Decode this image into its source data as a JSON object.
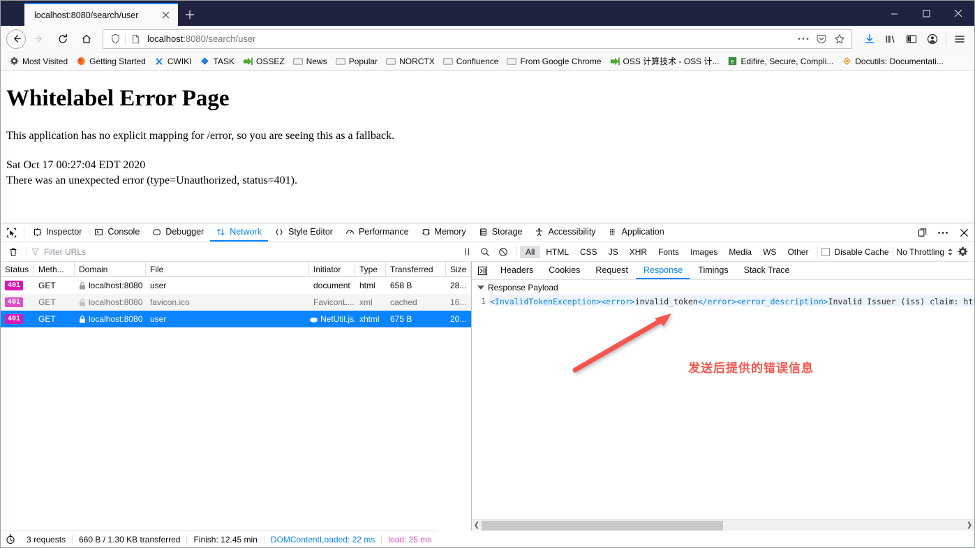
{
  "window": {
    "minimize": "—",
    "maximize": "▢",
    "close": "✕"
  },
  "tabs": [
    {
      "title": "localhost:8080/search/user",
      "close": "✕"
    }
  ],
  "newtab_label": "+",
  "nav": {
    "back": "←",
    "forward": "→",
    "reload": "⟳",
    "home": "⌂",
    "url_display": "localhost:8080/search/user",
    "url_host": "localhost",
    "url_rest": ":8080/search/user",
    "page_actions": "•••",
    "pocket": "save-to-pocket",
    "bookmark_star": "☆"
  },
  "toolbar_icons": [
    {
      "name": "downloads-icon",
      "glyph": "⭳"
    },
    {
      "name": "library-icon",
      "glyph": "|||\\"
    },
    {
      "name": "sidebar-icon",
      "glyph": "▤"
    },
    {
      "name": "account-icon",
      "glyph": "☻"
    },
    {
      "name": "menu-icon",
      "glyph": "☰"
    }
  ],
  "bookmarks": [
    {
      "label": "Most Visited",
      "icon": "gear-icon"
    },
    {
      "label": "Getting Started",
      "icon": "firefox-icon"
    },
    {
      "label": "CWIKI",
      "icon": "cwiki-icon"
    },
    {
      "label": "TASK",
      "icon": "diamond-icon"
    },
    {
      "label": "OSSEZ",
      "icon": "green-arrow-icon"
    },
    {
      "label": "News",
      "icon": "folder-icon"
    },
    {
      "label": "Popular",
      "icon": "folder-icon"
    },
    {
      "label": "NORCTX",
      "icon": "folder-icon"
    },
    {
      "label": "Confluence",
      "icon": "folder-icon"
    },
    {
      "label": "From Google Chrome",
      "icon": "folder-icon"
    },
    {
      "label": "OSS 计算技术 - OSS 计...",
      "icon": "green-arrow-icon"
    },
    {
      "label": "Edifire, Secure, Compli...",
      "icon": "edifire-icon"
    },
    {
      "label": "Docutils: Documentati...",
      "icon": "docutils-icon"
    }
  ],
  "page": {
    "heading": "Whitelabel Error Page",
    "paragraph": "This application has no explicit mapping for /error, so you are seeing this as a fallback.",
    "timestamp": "Sat Oct 17 00:27:04 EDT 2020",
    "error_line": "There was an unexpected error (type=Unauthorized, status=401)."
  },
  "devtools": {
    "picker_icon": "element-picker-icon",
    "tabs": [
      {
        "label": "Inspector",
        "icon": "inspector-icon",
        "active": false
      },
      {
        "label": "Console",
        "icon": "console-icon",
        "active": false
      },
      {
        "label": "Debugger",
        "icon": "debugger-icon",
        "active": false
      },
      {
        "label": "Network",
        "icon": "network-icon",
        "active": true
      },
      {
        "label": "Style Editor",
        "icon": "style-editor-icon",
        "active": false
      },
      {
        "label": "Performance",
        "icon": "performance-icon",
        "active": false
      },
      {
        "label": "Memory",
        "icon": "memory-icon",
        "active": false
      },
      {
        "label": "Storage",
        "icon": "storage-icon",
        "active": false
      },
      {
        "label": "Accessibility",
        "icon": "accessibility-icon",
        "active": false
      },
      {
        "label": "Application",
        "icon": "application-icon",
        "active": false
      }
    ],
    "right_buttons": [
      {
        "name": "dock-to-side-icon",
        "glyph": "❐"
      },
      {
        "name": "more-options-icon",
        "glyph": "•••"
      },
      {
        "name": "close-devtools-icon",
        "glyph": "✕"
      }
    ],
    "filterbar": {
      "trash_icon": "trash-icon",
      "filter_placeholder": "Filter URLs",
      "pause_icon": "pause-icon",
      "search_icon": "search-icon",
      "block_icon": "block-icon",
      "types": [
        {
          "label": "All",
          "active": true
        },
        {
          "label": "HTML",
          "active": false
        },
        {
          "label": "CSS",
          "active": false
        },
        {
          "label": "JS",
          "active": false
        },
        {
          "label": "XHR",
          "active": false
        },
        {
          "label": "Fonts",
          "active": false
        },
        {
          "label": "Images",
          "active": false
        },
        {
          "label": "Media",
          "active": false
        },
        {
          "label": "WS",
          "active": false
        },
        {
          "label": "Other",
          "active": false
        }
      ],
      "disable_cache_label": "Disable Cache",
      "throttling_label": "No Throttling",
      "throttling_chevron": "⇅",
      "settings_icon": "gear-icon"
    },
    "table": {
      "columns": [
        "Status",
        "Meth...",
        "Domain",
        "File",
        "Initiator",
        "Type",
        "Transferred",
        "Size"
      ],
      "rows": [
        {
          "status": "401",
          "method": "GET",
          "domain": "localhost:8080",
          "file": "user",
          "initiator": "document",
          "type": "html",
          "transferred": "658 B",
          "size": "28...",
          "selected": false,
          "dim": false,
          "initiator_link": false,
          "has_lock": true
        },
        {
          "status": "401",
          "method": "GET",
          "domain": "localhost:8080",
          "file": "favicon.ico",
          "initiator": "FaviconL...",
          "type": "xml",
          "transferred": "cached",
          "size": "16...",
          "selected": false,
          "dim": true,
          "initiator_link": true,
          "has_lock": true
        },
        {
          "status": "401",
          "method": "GET",
          "domain": "localhost:8080",
          "file": "user",
          "initiator": "NetUtil.js...",
          "type": "xhtml",
          "transferred": "675 B",
          "size": "20...",
          "selected": true,
          "dim": false,
          "initiator_link": true,
          "has_lock": true
        }
      ]
    },
    "details": {
      "resend_icon": "resend-request-icon",
      "tabs": [
        {
          "label": "Headers",
          "active": false
        },
        {
          "label": "Cookies",
          "active": false
        },
        {
          "label": "Request",
          "active": false
        },
        {
          "label": "Response",
          "active": true
        },
        {
          "label": "Timings",
          "active": false
        },
        {
          "label": "Stack Trace",
          "active": false
        }
      ],
      "payload_header": "Response Payload",
      "line_number": "1",
      "payload_segments": [
        {
          "text": "<InvalidTokenException><error>",
          "kind": "tag"
        },
        {
          "text": "invalid_token",
          "kind": "text"
        },
        {
          "text": "</error><error_description>",
          "kind": "tag"
        },
        {
          "text": "Invalid Issuer (iss) claim: https://sts.wi",
          "kind": "text"
        }
      ]
    },
    "statusbar": {
      "clock_icon": "stopwatch-icon",
      "requests": "3 requests",
      "transferred": "660 B / 1.30 KB transferred",
      "finish": "Finish: 12.45 min",
      "domcontentloaded": "DOMContentLoaded: 22 ms",
      "load": "load: 25 ms"
    },
    "hscroll": {
      "left_arrow": "❮",
      "right_arrow": "❯"
    }
  },
  "annotation": {
    "text": "发送后提供的错误信息",
    "color": "#f4574f"
  },
  "colors": {
    "titlebar": "#20233f",
    "accent": "#0a84ff",
    "status_badge": "#d818b7",
    "selected_row": "#0a84ff",
    "annotation": "#f4574f",
    "load_pink": "#e754c4"
  }
}
